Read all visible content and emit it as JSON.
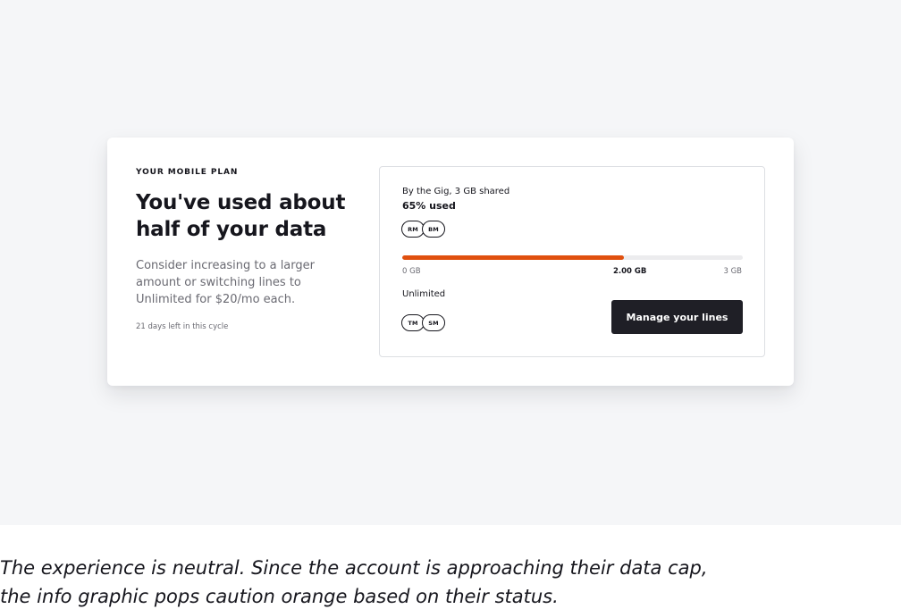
{
  "plan": {
    "eyebrow": "YOUR MOBILE PLAN",
    "headline_line1": "You've used about",
    "headline_line2": "half of your data",
    "body_line1": "Consider increasing to a larger",
    "body_line2": "amount or switching lines to",
    "body_line3": "Unlimited for $20/mo each.",
    "days_left": "21 days left in this cycle"
  },
  "usage": {
    "plan_name": "By the Gig, 3 GB shared",
    "used_label": "65% used",
    "used_fraction": 0.65,
    "bar_color": "#e0500f",
    "tick_min": "0 GB",
    "tick_current": "2.00 GB",
    "tick_max": "3 GB",
    "shared_lines": [
      "RM",
      "BM"
    ],
    "unlimited_label": "Unlimited",
    "unlimited_lines": [
      "TM",
      "SM"
    ],
    "manage_button": "Manage your lines"
  },
  "caption": {
    "line1": "The experience is neutral. Since the account is approaching their data cap,",
    "line2": "the info graphic pops caution orange based on their status."
  }
}
